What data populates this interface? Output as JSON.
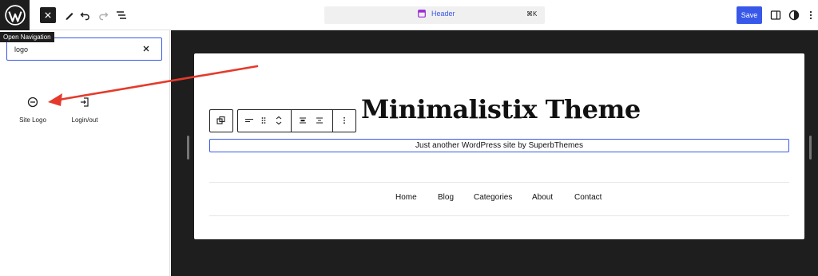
{
  "topbar": {
    "tooltip": "Open Navigation",
    "command_label": "Header",
    "command_shortcut": "⌘K",
    "save_label": "Save"
  },
  "inserter": {
    "search_value": "logo",
    "blocks": [
      {
        "label": "Site Logo",
        "icon": "site-logo-icon"
      },
      {
        "label": "Login/out",
        "icon": "login-icon"
      }
    ]
  },
  "site": {
    "title": "Minimalistix Theme",
    "tagline": "Just another WordPress site by SuperbThemes",
    "nav": [
      "Home",
      "Blog",
      "Categories",
      "About",
      "Contact"
    ]
  },
  "colors": {
    "accent": "#3858e9",
    "dark": "#1e1e1e",
    "arrow": "#e53a2b"
  }
}
